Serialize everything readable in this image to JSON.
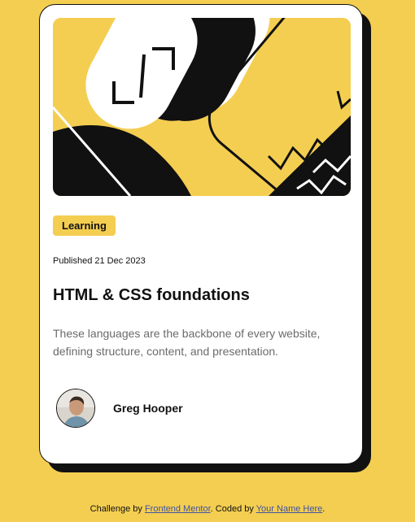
{
  "card": {
    "image_icon": "abstract-illustration",
    "badge": "Learning",
    "published": "Published 21 Dec 2023",
    "title": "HTML & CSS foundations",
    "description": "These languages are the backbone of every website, defining structure, content, and presentation.",
    "author": {
      "name": "Greg Hooper",
      "avatar_icon": "avatar-photo"
    }
  },
  "footer": {
    "prefix": "Challenge by ",
    "link1": "Frontend Mentor",
    "middle": ". Coded by ",
    "link2": "Your Name Here",
    "suffix": "."
  },
  "colors": {
    "background": "#f4ce51",
    "card": "#ffffff",
    "ink": "#111111",
    "muted_text": "#6b6b6b",
    "link": "#3e52a3"
  }
}
